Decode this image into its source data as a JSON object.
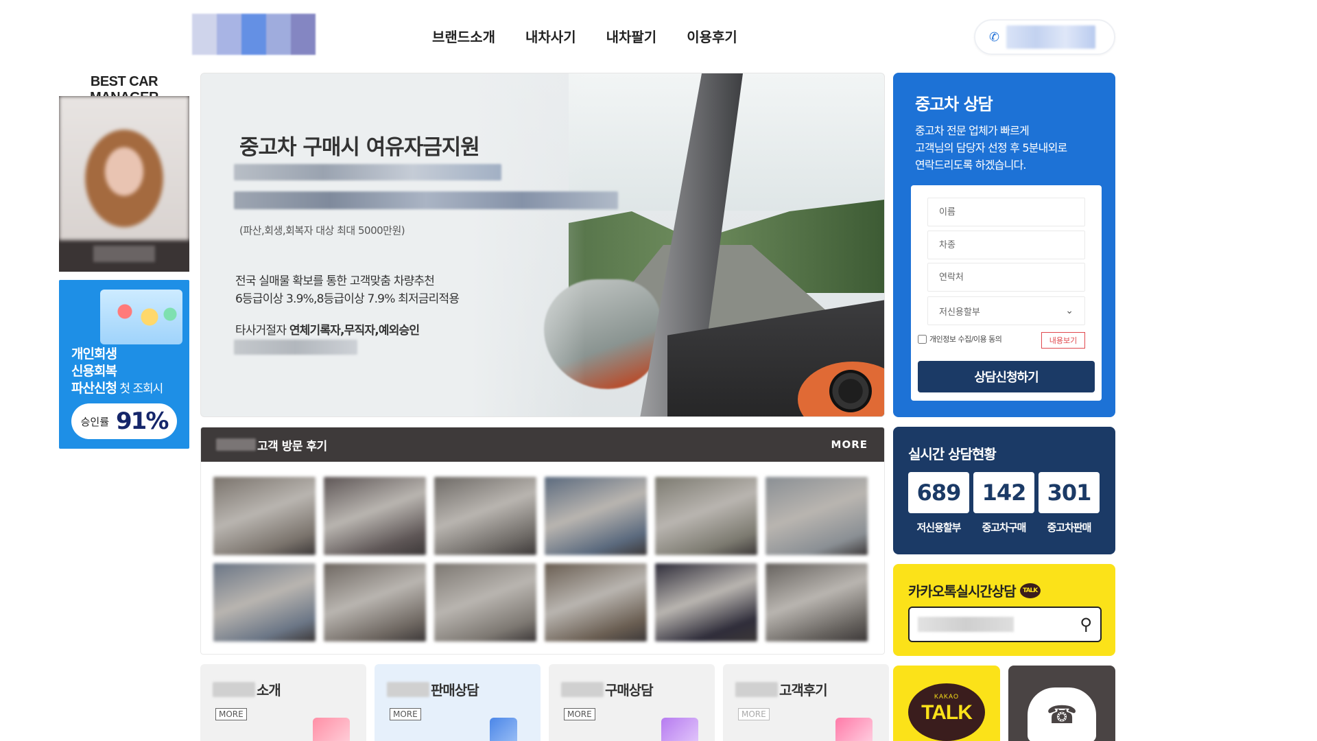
{
  "header": {
    "nav": [
      "브랜드소개",
      "내차사기",
      "내차팔기",
      "이용후기"
    ],
    "phone_icon": "phone-icon",
    "accent": "#2272d8"
  },
  "manager": {
    "title": "BEST CAR MANAGER"
  },
  "left_banner": {
    "line1": "개인회생",
    "line2": "신용회복",
    "line3": "파산신청",
    "line3_suffix": " 첫 조회시",
    "rate_label": "승인률",
    "rate_value": "91%"
  },
  "hero": {
    "headline": "중고차 구매시 여유자금지원",
    "note": "(파산,회생,회복자 대상 최대 5000만원)",
    "line1": "전국 실매물 확보를 통한 고객맞춤 차량추천",
    "line2": "6등급이상 3.9%,8등급이상 7.9% 최저금리적용",
    "line3_prefix": "타사거절자 ",
    "line3_bold": "연체기록자,무직자,예외승인"
  },
  "consult": {
    "title": "중고차 상담",
    "desc1": "중고차 전문 업체가 빠르게",
    "desc2": "고객님의 담당자 선정 후 5분내외로",
    "desc3": "연락드리도록 하겠습니다.",
    "name_placeholder": "이름",
    "car_placeholder": "차종",
    "contact_placeholder": "연락처",
    "select_value": "저신용할부",
    "agree_label": "개인정보 수집/이용 동의",
    "view_label": "내용보기",
    "submit_label": "상담신청하기",
    "bg_color": "#1d72d6",
    "submit_color": "#1b3a66"
  },
  "reviews": {
    "title": "고객 방문 후기",
    "more": "MORE",
    "thumbs": [
      "#7a736c",
      "#5e5656",
      "#6e6a66",
      "#5b6a7e",
      "#7c7a70",
      "#8a8f94",
      "#6b7686",
      "#6f6862",
      "#7d7872",
      "#6a5e52",
      "#2f2d3a",
      "#66625e"
    ]
  },
  "realtime": {
    "title": "실시간 상담현황",
    "stats": [
      {
        "value": "689",
        "label": "저신용할부"
      },
      {
        "value": "142",
        "label": "중고차구매"
      },
      {
        "value": "301",
        "label": "중고차판매"
      }
    ]
  },
  "kakao": {
    "title": "카카오톡실시간상담",
    "badge": "TALK",
    "search_icon": "search-icon"
  },
  "cards": [
    {
      "title": "소개",
      "more": "MORE"
    },
    {
      "title": "판매상담",
      "more": "MORE"
    },
    {
      "title": "구매상담",
      "more": "MORE"
    },
    {
      "title": "고객후기",
      "more": "MORE"
    }
  ],
  "kakao_talk": {
    "small": "KAKAO",
    "big": "TALK"
  }
}
